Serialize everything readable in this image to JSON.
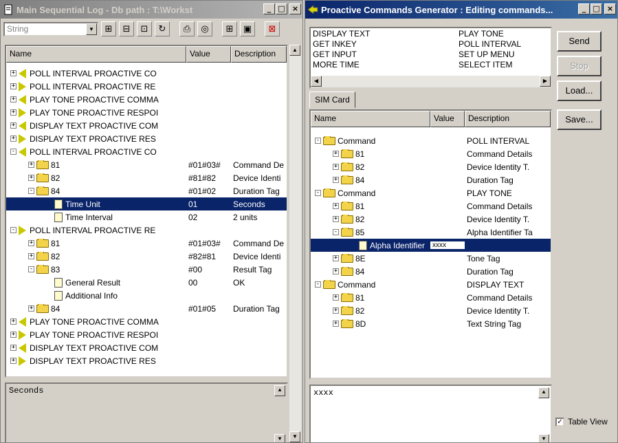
{
  "window1": {
    "title": "Main Sequential Log  -  Db path : T:\\Workst",
    "combo_value": "String",
    "columns": [
      "Name",
      "Value",
      "Description"
    ],
    "rows": [
      {
        "indent": 0,
        "exp": "+",
        "icon": "arrowL",
        "name": "POLL INTERVAL PROACTIVE CO",
        "value": "",
        "desc": ""
      },
      {
        "indent": 0,
        "exp": "+",
        "icon": "arrowR",
        "name": "POLL INTERVAL PROACTIVE RE",
        "value": "",
        "desc": ""
      },
      {
        "indent": 0,
        "exp": "+",
        "icon": "arrowL",
        "name": "PLAY TONE PROACTIVE COMMA",
        "value": "",
        "desc": ""
      },
      {
        "indent": 0,
        "exp": "+",
        "icon": "arrowR",
        "name": "PLAY TONE PROACTIVE RESPOI",
        "value": "",
        "desc": ""
      },
      {
        "indent": 0,
        "exp": "+",
        "icon": "arrowL",
        "name": "DISPLAY TEXT PROACTIVE COM",
        "value": "",
        "desc": ""
      },
      {
        "indent": 0,
        "exp": "+",
        "icon": "arrowR",
        "name": "DISPLAY TEXT PROACTIVE RES",
        "value": "",
        "desc": ""
      },
      {
        "indent": 0,
        "exp": "-",
        "icon": "arrowL",
        "name": "POLL INTERVAL PROACTIVE CO",
        "value": "",
        "desc": ""
      },
      {
        "indent": 1,
        "exp": "+",
        "icon": "folder",
        "name": "81",
        "value": "#01#03#",
        "desc": "Command De"
      },
      {
        "indent": 1,
        "exp": "+",
        "icon": "folder",
        "name": "82",
        "value": "#81#82",
        "desc": "Device Identi"
      },
      {
        "indent": 1,
        "exp": "-",
        "icon": "folder",
        "name": "84",
        "value": "#01#02",
        "desc": "Duration Tag"
      },
      {
        "indent": 2,
        "exp": "",
        "icon": "doc",
        "name": "Time Unit",
        "value": "01",
        "desc": "Seconds",
        "selected": true
      },
      {
        "indent": 2,
        "exp": "",
        "icon": "doc",
        "name": "Time Interval",
        "value": "02",
        "desc": "2 units"
      },
      {
        "indent": 0,
        "exp": "-",
        "icon": "arrowR",
        "name": "POLL INTERVAL PROACTIVE RE",
        "value": "",
        "desc": ""
      },
      {
        "indent": 1,
        "exp": "+",
        "icon": "folder",
        "name": "81",
        "value": "#01#03#",
        "desc": "Command De"
      },
      {
        "indent": 1,
        "exp": "+",
        "icon": "folder",
        "name": "82",
        "value": "#82#81",
        "desc": "Device Identi"
      },
      {
        "indent": 1,
        "exp": "-",
        "icon": "folder",
        "name": "83",
        "value": "#00",
        "desc": "Result Tag"
      },
      {
        "indent": 2,
        "exp": "",
        "icon": "doc",
        "name": "General Result",
        "value": "00",
        "desc": "OK"
      },
      {
        "indent": 2,
        "exp": "",
        "icon": "doc",
        "name": "Additional Info",
        "value": "",
        "desc": ""
      },
      {
        "indent": 1,
        "exp": "+",
        "icon": "folder",
        "name": "84",
        "value": "#01#05",
        "desc": "Duration Tag"
      },
      {
        "indent": 0,
        "exp": "+",
        "icon": "arrowL",
        "name": "PLAY TONE PROACTIVE COMMA",
        "value": "",
        "desc": ""
      },
      {
        "indent": 0,
        "exp": "+",
        "icon": "arrowR",
        "name": "PLAY TONE PROACTIVE RESPOI",
        "value": "",
        "desc": ""
      },
      {
        "indent": 0,
        "exp": "+",
        "icon": "arrowL",
        "name": "DISPLAY TEXT PROACTIVE COM",
        "value": "",
        "desc": ""
      },
      {
        "indent": 0,
        "exp": "+",
        "icon": "arrowR",
        "name": "DISPLAY TEXT PROACTIVE RES",
        "value": "",
        "desc": ""
      }
    ],
    "detail_text": "Seconds"
  },
  "window2": {
    "title": "Proactive Commands Generator : Editing commands...",
    "commands_col1": [
      "DISPLAY TEXT",
      "GET INKEY",
      "GET INPUT",
      "MORE TIME"
    ],
    "commands_col2": [
      "PLAY TONE",
      "POLL INTERVAL",
      "SET UP MENU",
      "SELECT ITEM"
    ],
    "tab_label": "SIM Card",
    "columns": [
      "Name",
      "Value",
      "Description"
    ],
    "rows": [
      {
        "indent": 0,
        "exp": "-",
        "icon": "folder",
        "name": "Command",
        "value": "",
        "desc": "POLL INTERVAL"
      },
      {
        "indent": 1,
        "exp": "+",
        "icon": "folder",
        "name": "81",
        "value": "",
        "desc": "Command Details"
      },
      {
        "indent": 1,
        "exp": "+",
        "icon": "folder",
        "name": "82",
        "value": "",
        "desc": "Device Identity T."
      },
      {
        "indent": 1,
        "exp": "+",
        "icon": "folder",
        "name": "84",
        "value": "",
        "desc": "Duration Tag"
      },
      {
        "indent": 0,
        "exp": "-",
        "icon": "folder",
        "name": "Command",
        "value": "",
        "desc": "PLAY TONE"
      },
      {
        "indent": 1,
        "exp": "+",
        "icon": "folder",
        "name": "81",
        "value": "",
        "desc": "Command Details"
      },
      {
        "indent": 1,
        "exp": "+",
        "icon": "folder",
        "name": "82",
        "value": "",
        "desc": "Device Identity T."
      },
      {
        "indent": 1,
        "exp": "-",
        "icon": "folder",
        "name": "85",
        "value": "",
        "desc": "Alpha Identifier Ta"
      },
      {
        "indent": 2,
        "exp": "",
        "icon": "doc",
        "name": "Alpha Identifier",
        "value": "xxxx",
        "desc": "",
        "selected": true
      },
      {
        "indent": 1,
        "exp": "+",
        "icon": "folder",
        "name": "8E",
        "value": "",
        "desc": "Tone Tag"
      },
      {
        "indent": 1,
        "exp": "+",
        "icon": "folder",
        "name": "84",
        "value": "",
        "desc": "Duration Tag"
      },
      {
        "indent": 0,
        "exp": "-",
        "icon": "folder",
        "name": "Command",
        "value": "",
        "desc": "DISPLAY TEXT"
      },
      {
        "indent": 1,
        "exp": "+",
        "icon": "folder",
        "name": "81",
        "value": "",
        "desc": "Command Details"
      },
      {
        "indent": 1,
        "exp": "+",
        "icon": "folder",
        "name": "82",
        "value": "",
        "desc": "Device Identity T."
      },
      {
        "indent": 1,
        "exp": "+",
        "icon": "folder",
        "name": "8D",
        "value": "",
        "desc": "Text String Tag"
      }
    ],
    "edit_text": "xxxx",
    "buttons": {
      "send": "Send",
      "stop": "Stop",
      "load": "Load...",
      "save": "Save..."
    },
    "table_view_label": "Table View"
  }
}
